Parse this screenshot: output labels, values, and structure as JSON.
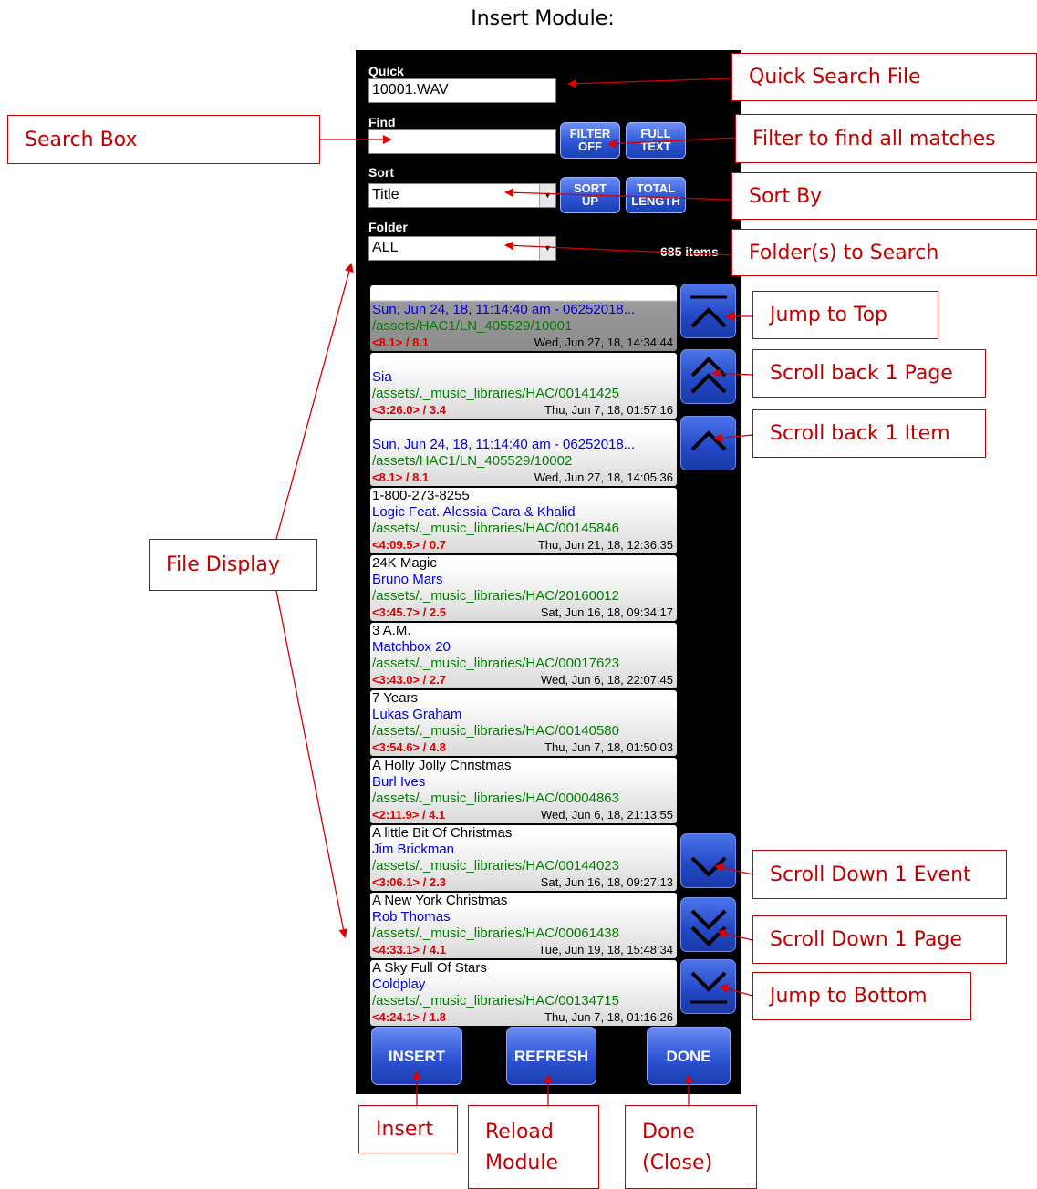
{
  "page_title": "Insert Module:",
  "controls": {
    "quick_label": "Quick",
    "quick_value": "10001.WAV",
    "find_label": "Find",
    "find_value": "",
    "sort_label": "Sort",
    "sort_value": "Title",
    "folder_label": "Folder",
    "folder_value": "ALL",
    "filter_button": [
      "FILTER",
      "OFF"
    ],
    "full_text_button": [
      "FULL",
      "TEXT"
    ],
    "sort_up_button": [
      "SORT",
      "UP"
    ],
    "total_length_button": [
      "TOTAL",
      "LENGTH"
    ],
    "item_count": "685 items"
  },
  "items": [
    {
      "title": "",
      "artist": "Sun, Jun 24, 18, 11:14:40 am - 06252018...",
      "path": "/assets/HAC1/LN_405529/10001",
      "duration": "<8.1> / 8.1",
      "date": "Wed, Jun 27, 18, 14:34:44",
      "selected": true
    },
    {
      "title": "",
      "artist": "Sia",
      "path": "/assets/._music_libraries/HAC/00141425",
      "duration": "<3:26.0> / 3.4",
      "date": "Thu, Jun 7, 18, 01:57:16",
      "selected": false
    },
    {
      "title": "",
      "artist": "Sun, Jun 24, 18, 11:14:40 am - 06252018...",
      "path": "/assets/HAC1/LN_405529/10002",
      "duration": "<8.1> / 8.1",
      "date": "Wed, Jun 27, 18, 14:05:36",
      "selected": false
    },
    {
      "title": "1-800-273-8255",
      "artist": "Logic Feat. Alessia Cara & Khalid",
      "path": "/assets/._music_libraries/HAC/00145846",
      "duration": "<4:09.5> / 0.7",
      "date": "Thu, Jun 21, 18, 12:36:35",
      "selected": false
    },
    {
      "title": "24K Magic",
      "artist": "Bruno Mars",
      "path": "/assets/._music_libraries/HAC/20160012",
      "duration": "<3:45.7> / 2.5",
      "date": "Sat, Jun 16, 18, 09:34:17",
      "selected": false
    },
    {
      "title": "3 A.M.",
      "artist": "Matchbox 20",
      "path": "/assets/._music_libraries/HAC/00017623",
      "duration": "<3:43.0> / 2.7",
      "date": "Wed, Jun 6, 18, 22:07:45",
      "selected": false
    },
    {
      "title": "7 Years",
      "artist": "Lukas Graham",
      "path": "/assets/._music_libraries/HAC/00140580",
      "duration": "<3:54.6> / 4.8",
      "date": "Thu, Jun 7, 18, 01:50:03",
      "selected": false
    },
    {
      "title": "A Holly Jolly Christmas",
      "artist": "Burl Ives",
      "path": "/assets/._music_libraries/HAC/00004863",
      "duration": "<2:11.9> / 4.1",
      "date": "Wed, Jun 6, 18, 21:13:55",
      "selected": false
    },
    {
      "title": "A little Bit Of Christmas",
      "artist": "Jim Brickman",
      "path": "/assets/._music_libraries/HAC/00144023",
      "duration": "<3:06.1> / 2.3",
      "date": "Sat, Jun 16, 18, 09:27:13",
      "selected": false
    },
    {
      "title": "A New York Christmas",
      "artist": "Rob Thomas",
      "path": "/assets/._music_libraries/HAC/00061438",
      "duration": "<4:33.1> / 4.1",
      "date": "Tue, Jun 19, 18, 15:48:34",
      "selected": false
    },
    {
      "title": "A Sky Full Of Stars",
      "artist": "Coldplay",
      "path": "/assets/._music_libraries/HAC/00134715",
      "duration": "<4:24.1> / 1.8",
      "date": "Thu, Jun 7, 18, 01:16:26",
      "selected": false
    }
  ],
  "bottom_buttons": {
    "insert": "INSERT",
    "refresh": "REFRESH",
    "done": "DONE"
  },
  "callouts": {
    "quick_search": "Quick Search File",
    "search_box": "Search Box",
    "filter": "Filter to find all matches",
    "sort_by": "Sort By",
    "folders": "Folder(s) to Search",
    "jump_top": "Jump to Top",
    "scroll_back_page": "Scroll back 1 Page",
    "scroll_back_item": "Scroll back 1 Item",
    "file_display": "File Display",
    "scroll_down_event": "Scroll Down 1 Event",
    "scroll_down_page": "Scroll Down 1 Page",
    "jump_bottom": "Jump to Bottom",
    "insert": "Insert",
    "reload": [
      "Reload",
      "Module"
    ],
    "done": [
      "Done",
      "(Close)"
    ]
  },
  "colors": {
    "callout": "#c00000",
    "button_blue": "#2e55d6",
    "panel": "#000000"
  }
}
